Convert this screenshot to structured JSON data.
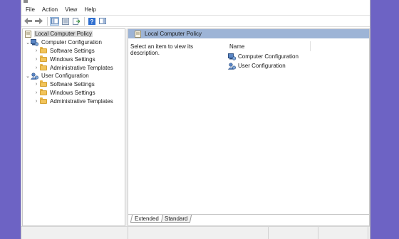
{
  "menubar": {
    "items": [
      "File",
      "Action",
      "View",
      "Help"
    ]
  },
  "toolbar": {
    "buttons": [
      "back-icon",
      "forward-icon",
      "console-tree-icon",
      "properties-icon",
      "export-list-icon",
      "help-icon",
      "show-hide-action-pane-icon"
    ]
  },
  "tree": {
    "root": "Local Computer Policy",
    "computer": {
      "label": "Computer Configuration",
      "children": [
        "Software Settings",
        "Windows Settings",
        "Administrative Templates"
      ]
    },
    "user": {
      "label": "User Configuration",
      "children": [
        "Software Settings",
        "Windows Settings",
        "Administrative Templates"
      ]
    }
  },
  "details": {
    "header": "Local Computer Policy",
    "description": "Select an item to view its description.",
    "column_name": "Name",
    "items": [
      "Computer Configuration",
      "User Configuration"
    ]
  },
  "tabs": [
    "Extended",
    "Standard"
  ],
  "colors": {
    "desktop": "#6d63c4",
    "header_strip": "#9db4d6",
    "folder": "#f2c45a"
  }
}
